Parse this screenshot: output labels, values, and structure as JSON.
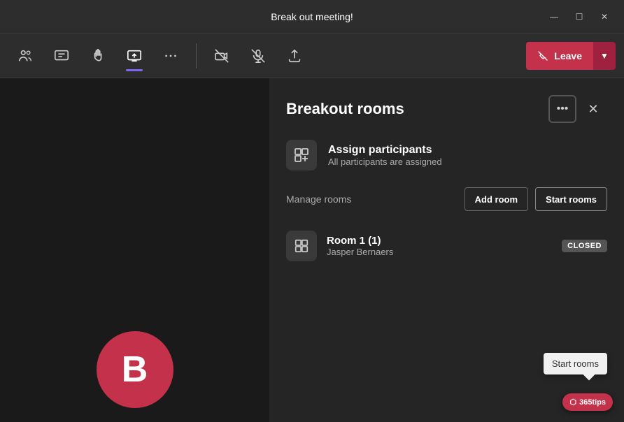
{
  "titleBar": {
    "title": "Break out meeting!",
    "minBtn": "—",
    "maxBtn": "☐",
    "closeBtn": "✕"
  },
  "toolbar": {
    "peopleBtn": "people-icon",
    "chatBtn": "chat-icon",
    "raiseHandBtn": "raise-hand-icon",
    "shareScreenBtn": "share-screen-icon",
    "moreBtn": "more-icon",
    "cameraBtn": "camera-off-icon",
    "micBtn": "mic-off-icon",
    "shareBtn": "share-icon",
    "leaveLabel": "Leave",
    "leaveChevron": "▼"
  },
  "breakoutPanel": {
    "title": "Breakout rooms",
    "moreBtn": "•••",
    "closeBtn": "✕",
    "assign": {
      "iconLabel": "assign-icon",
      "title": "Assign participants",
      "subtitle": "All participants are assigned"
    },
    "manageLabel": "Manage rooms",
    "addRoomLabel": "Add room",
    "startRoomsLabel": "Start rooms",
    "rooms": [
      {
        "name": "Room 1 (1)",
        "host": "Jasper Bernaers",
        "status": "CLOSED"
      }
    ],
    "tooltip": "Start rooms"
  },
  "avatar": {
    "letter": "B"
  },
  "tipsBadge": "365tips"
}
